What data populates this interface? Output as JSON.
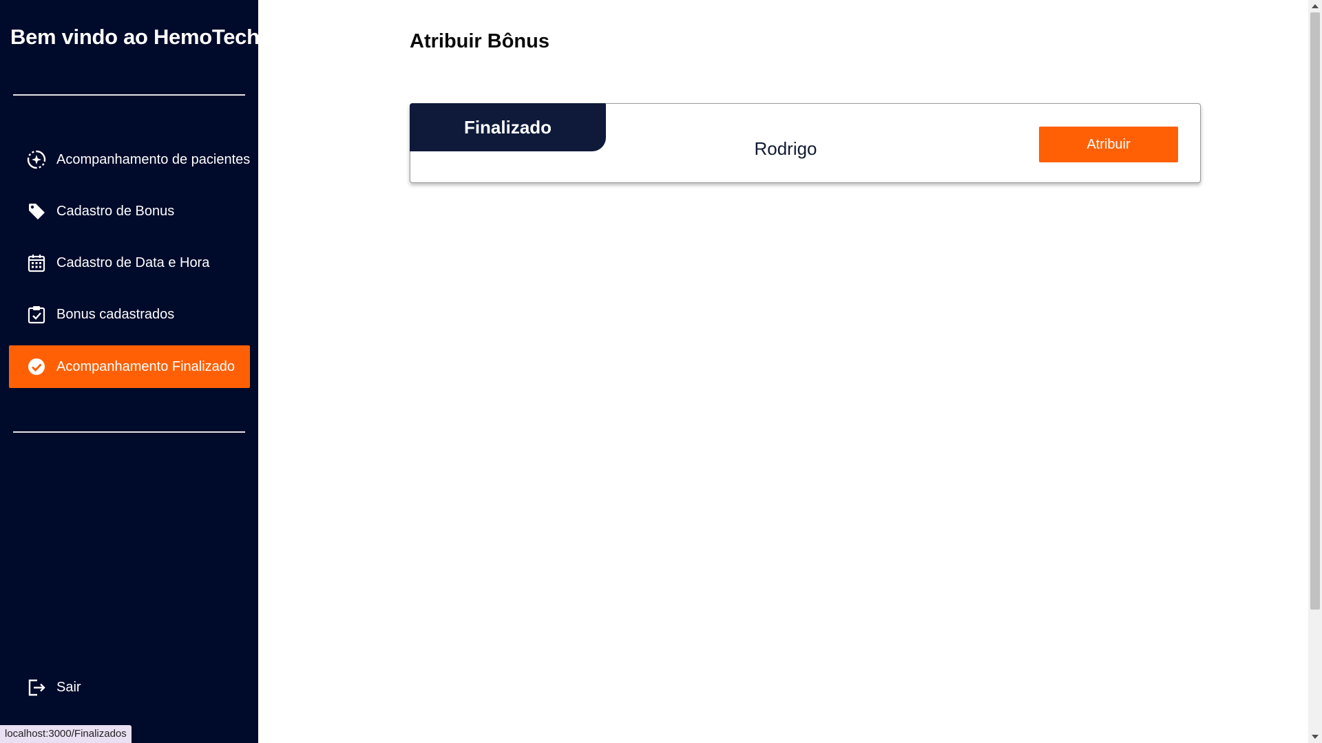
{
  "sidebar": {
    "brand": "Bem vindo ao HemoTech",
    "items": [
      {
        "label": "Acompanhamento de pacientes",
        "icon": "patient-tracking-icon"
      },
      {
        "label": "Cadastro de Bonus",
        "icon": "tag-icon"
      },
      {
        "label": "Cadastro de Data e Hora",
        "icon": "calendar-icon"
      },
      {
        "label": "Bonus cadastrados",
        "icon": "clipboard-check-icon"
      },
      {
        "label": "Acompanhamento Finalizado",
        "icon": "check-circle-icon",
        "active": true
      }
    ],
    "logout": {
      "label": "Sair",
      "icon": "logout-icon"
    }
  },
  "main": {
    "title": "Atribuir Bônus",
    "cards": [
      {
        "status": "Finalizado",
        "name": "Rodrigo",
        "action_label": "Atribuir"
      }
    ]
  },
  "status_bar": {
    "url": "localhost:3000/Finalizados"
  },
  "colors": {
    "sidebar_bg": "#000a2a",
    "accent": "#ff6005",
    "tag_bg": "#0f1a3a"
  }
}
